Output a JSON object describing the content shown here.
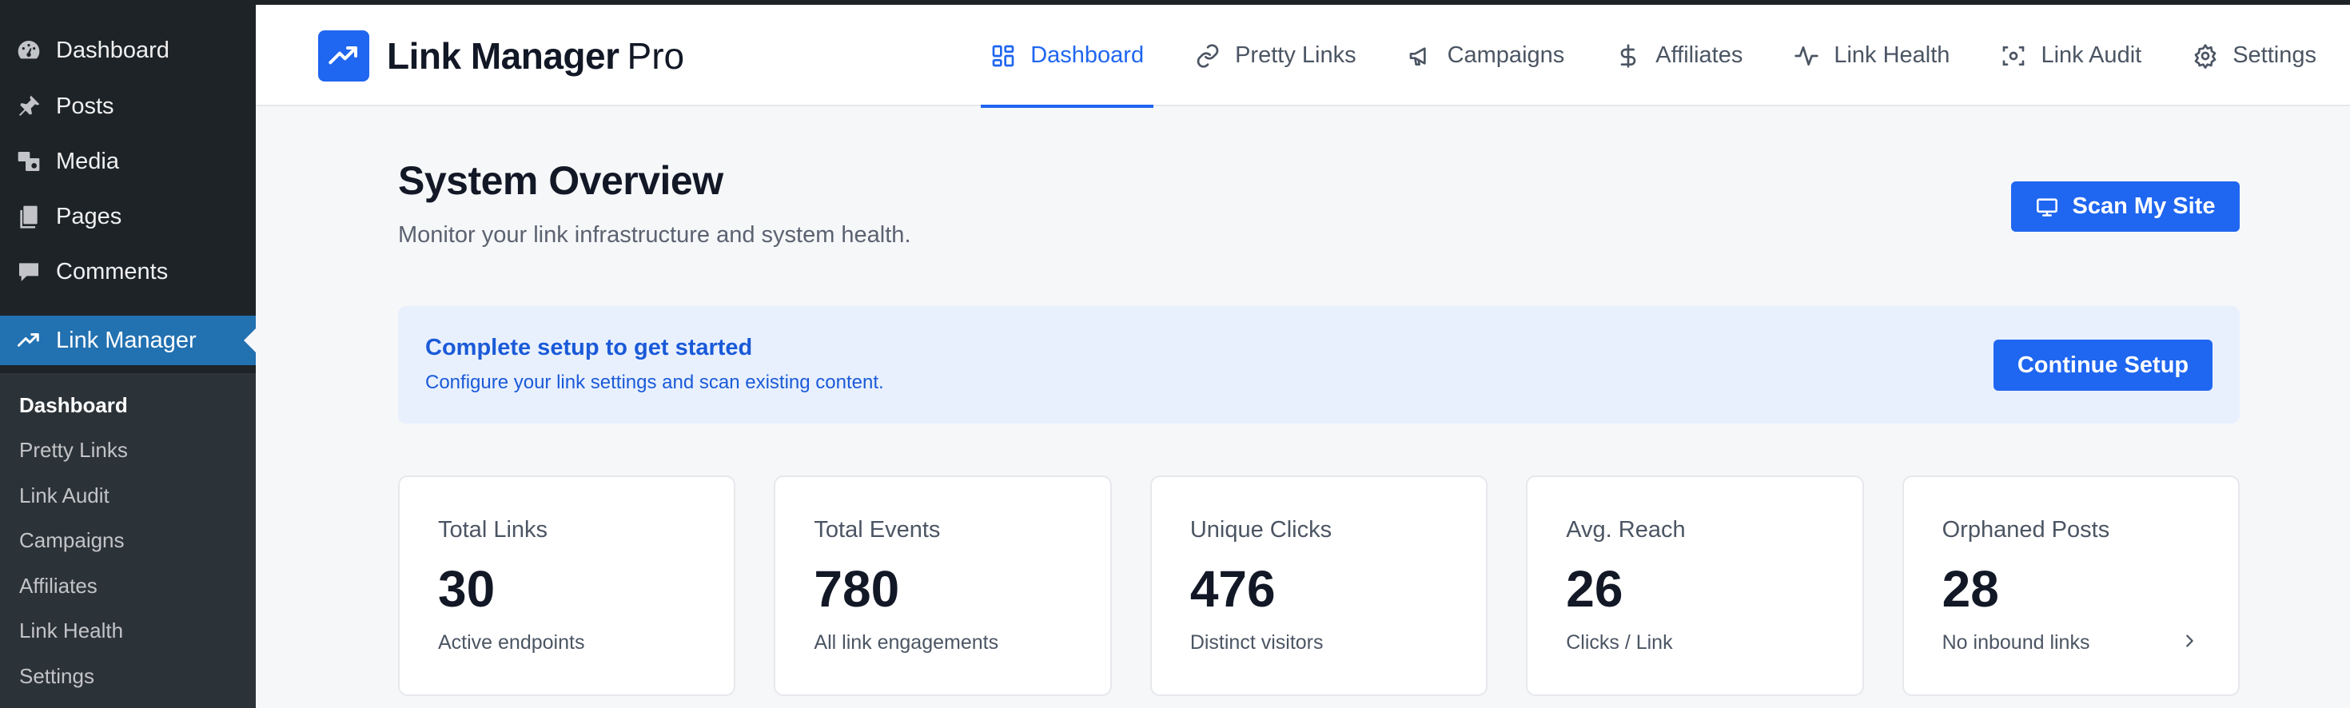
{
  "wp_menu": {
    "items": [
      {
        "label": "Dashboard",
        "icon": "dashboard-gauge-icon"
      },
      {
        "label": "Posts",
        "icon": "pushpin-icon"
      },
      {
        "label": "Media",
        "icon": "media-icon"
      },
      {
        "label": "Pages",
        "icon": "pages-icon"
      },
      {
        "label": "Comments",
        "icon": "comment-bubble-icon"
      },
      {
        "label": "Link Manager",
        "icon": "trend-up-icon"
      }
    ],
    "submenu": [
      "Dashboard",
      "Pretty Links",
      "Link Audit",
      "Campaigns",
      "Affiliates",
      "Link Health",
      "Settings"
    ]
  },
  "header": {
    "brand_name": "Link Manager",
    "brand_suffix": "Pro",
    "tabs": [
      {
        "label": "Dashboard",
        "icon": "dashboard-grid-icon"
      },
      {
        "label": "Pretty Links",
        "icon": "link-icon"
      },
      {
        "label": "Campaigns",
        "icon": "megaphone-icon"
      },
      {
        "label": "Affiliates",
        "icon": "dollar-icon"
      },
      {
        "label": "Link Health",
        "icon": "pulse-icon"
      },
      {
        "label": "Link Audit",
        "icon": "scan-icon"
      },
      {
        "label": "Settings",
        "icon": "gear-icon"
      }
    ]
  },
  "main": {
    "title": "System Overview",
    "subtitle": "Monitor your link infrastructure and system health.",
    "scan_button": "Scan My Site"
  },
  "banner": {
    "title": "Complete setup to get started",
    "text": "Configure your link settings and scan existing content.",
    "button": "Continue Setup"
  },
  "stats": [
    {
      "label": "Total Links",
      "value": "30",
      "caption": "Active endpoints"
    },
    {
      "label": "Total Events",
      "value": "780",
      "caption": "All link engagements"
    },
    {
      "label": "Unique Clicks",
      "value": "476",
      "caption": "Distinct visitors"
    },
    {
      "label": "Avg. Reach",
      "value": "26",
      "caption": "Clicks / Link"
    },
    {
      "label": "Orphaned Posts",
      "value": "28",
      "caption": "No inbound links"
    }
  ],
  "colors": {
    "accent": "#1f66f0",
    "wp_sidebar": "#1d2327",
    "wp_active": "#2271b1",
    "banner_bg": "#e8f0fe"
  }
}
